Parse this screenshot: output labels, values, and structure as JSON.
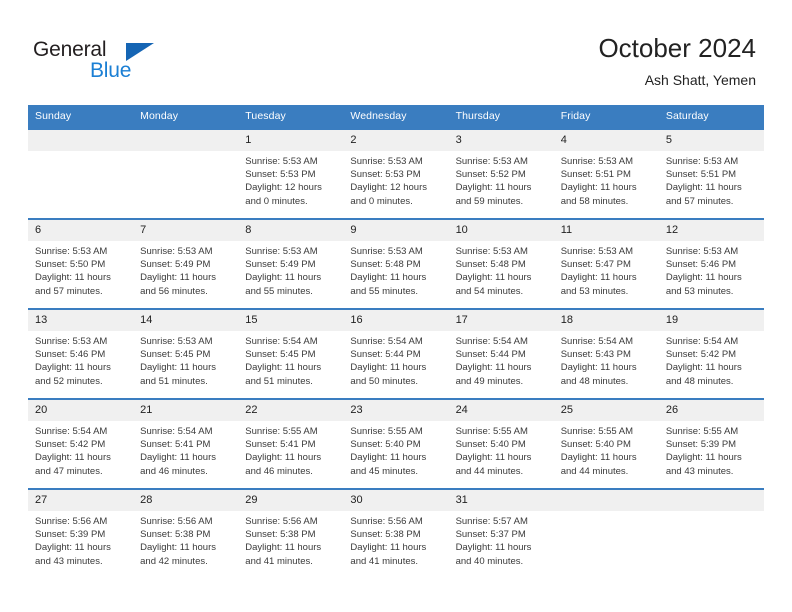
{
  "logo": {
    "word_top": "General",
    "word_bottom": "Blue",
    "triangle_color": "#1565b4",
    "blue_color": "#1b7fd4"
  },
  "header": {
    "title": "October 2024",
    "subtitle": "Ash Shatt, Yemen"
  },
  "theme": {
    "header_row_bg": "#3a7dc0",
    "daynum_bg": "#f0f0f0",
    "row_border": "#3a7dc0"
  },
  "weekdays": [
    "Sunday",
    "Monday",
    "Tuesday",
    "Wednesday",
    "Thursday",
    "Friday",
    "Saturday"
  ],
  "weeks": [
    [
      {
        "day": "",
        "sunrise": "",
        "sunset": "",
        "daylight1": "",
        "daylight2": ""
      },
      {
        "day": "",
        "sunrise": "",
        "sunset": "",
        "daylight1": "",
        "daylight2": ""
      },
      {
        "day": "1",
        "sunrise": "Sunrise: 5:53 AM",
        "sunset": "Sunset: 5:53 PM",
        "daylight1": "Daylight: 12 hours",
        "daylight2": "and 0 minutes."
      },
      {
        "day": "2",
        "sunrise": "Sunrise: 5:53 AM",
        "sunset": "Sunset: 5:53 PM",
        "daylight1": "Daylight: 12 hours",
        "daylight2": "and 0 minutes."
      },
      {
        "day": "3",
        "sunrise": "Sunrise: 5:53 AM",
        "sunset": "Sunset: 5:52 PM",
        "daylight1": "Daylight: 11 hours",
        "daylight2": "and 59 minutes."
      },
      {
        "day": "4",
        "sunrise": "Sunrise: 5:53 AM",
        "sunset": "Sunset: 5:51 PM",
        "daylight1": "Daylight: 11 hours",
        "daylight2": "and 58 minutes."
      },
      {
        "day": "5",
        "sunrise": "Sunrise: 5:53 AM",
        "sunset": "Sunset: 5:51 PM",
        "daylight1": "Daylight: 11 hours",
        "daylight2": "and 57 minutes."
      }
    ],
    [
      {
        "day": "6",
        "sunrise": "Sunrise: 5:53 AM",
        "sunset": "Sunset: 5:50 PM",
        "daylight1": "Daylight: 11 hours",
        "daylight2": "and 57 minutes."
      },
      {
        "day": "7",
        "sunrise": "Sunrise: 5:53 AM",
        "sunset": "Sunset: 5:49 PM",
        "daylight1": "Daylight: 11 hours",
        "daylight2": "and 56 minutes."
      },
      {
        "day": "8",
        "sunrise": "Sunrise: 5:53 AM",
        "sunset": "Sunset: 5:49 PM",
        "daylight1": "Daylight: 11 hours",
        "daylight2": "and 55 minutes."
      },
      {
        "day": "9",
        "sunrise": "Sunrise: 5:53 AM",
        "sunset": "Sunset: 5:48 PM",
        "daylight1": "Daylight: 11 hours",
        "daylight2": "and 55 minutes."
      },
      {
        "day": "10",
        "sunrise": "Sunrise: 5:53 AM",
        "sunset": "Sunset: 5:48 PM",
        "daylight1": "Daylight: 11 hours",
        "daylight2": "and 54 minutes."
      },
      {
        "day": "11",
        "sunrise": "Sunrise: 5:53 AM",
        "sunset": "Sunset: 5:47 PM",
        "daylight1": "Daylight: 11 hours",
        "daylight2": "and 53 minutes."
      },
      {
        "day": "12",
        "sunrise": "Sunrise: 5:53 AM",
        "sunset": "Sunset: 5:46 PM",
        "daylight1": "Daylight: 11 hours",
        "daylight2": "and 53 minutes."
      }
    ],
    [
      {
        "day": "13",
        "sunrise": "Sunrise: 5:53 AM",
        "sunset": "Sunset: 5:46 PM",
        "daylight1": "Daylight: 11 hours",
        "daylight2": "and 52 minutes."
      },
      {
        "day": "14",
        "sunrise": "Sunrise: 5:53 AM",
        "sunset": "Sunset: 5:45 PM",
        "daylight1": "Daylight: 11 hours",
        "daylight2": "and 51 minutes."
      },
      {
        "day": "15",
        "sunrise": "Sunrise: 5:54 AM",
        "sunset": "Sunset: 5:45 PM",
        "daylight1": "Daylight: 11 hours",
        "daylight2": "and 51 minutes."
      },
      {
        "day": "16",
        "sunrise": "Sunrise: 5:54 AM",
        "sunset": "Sunset: 5:44 PM",
        "daylight1": "Daylight: 11 hours",
        "daylight2": "and 50 minutes."
      },
      {
        "day": "17",
        "sunrise": "Sunrise: 5:54 AM",
        "sunset": "Sunset: 5:44 PM",
        "daylight1": "Daylight: 11 hours",
        "daylight2": "and 49 minutes."
      },
      {
        "day": "18",
        "sunrise": "Sunrise: 5:54 AM",
        "sunset": "Sunset: 5:43 PM",
        "daylight1": "Daylight: 11 hours",
        "daylight2": "and 48 minutes."
      },
      {
        "day": "19",
        "sunrise": "Sunrise: 5:54 AM",
        "sunset": "Sunset: 5:42 PM",
        "daylight1": "Daylight: 11 hours",
        "daylight2": "and 48 minutes."
      }
    ],
    [
      {
        "day": "20",
        "sunrise": "Sunrise: 5:54 AM",
        "sunset": "Sunset: 5:42 PM",
        "daylight1": "Daylight: 11 hours",
        "daylight2": "and 47 minutes."
      },
      {
        "day": "21",
        "sunrise": "Sunrise: 5:54 AM",
        "sunset": "Sunset: 5:41 PM",
        "daylight1": "Daylight: 11 hours",
        "daylight2": "and 46 minutes."
      },
      {
        "day": "22",
        "sunrise": "Sunrise: 5:55 AM",
        "sunset": "Sunset: 5:41 PM",
        "daylight1": "Daylight: 11 hours",
        "daylight2": "and 46 minutes."
      },
      {
        "day": "23",
        "sunrise": "Sunrise: 5:55 AM",
        "sunset": "Sunset: 5:40 PM",
        "daylight1": "Daylight: 11 hours",
        "daylight2": "and 45 minutes."
      },
      {
        "day": "24",
        "sunrise": "Sunrise: 5:55 AM",
        "sunset": "Sunset: 5:40 PM",
        "daylight1": "Daylight: 11 hours",
        "daylight2": "and 44 minutes."
      },
      {
        "day": "25",
        "sunrise": "Sunrise: 5:55 AM",
        "sunset": "Sunset: 5:40 PM",
        "daylight1": "Daylight: 11 hours",
        "daylight2": "and 44 minutes."
      },
      {
        "day": "26",
        "sunrise": "Sunrise: 5:55 AM",
        "sunset": "Sunset: 5:39 PM",
        "daylight1": "Daylight: 11 hours",
        "daylight2": "and 43 minutes."
      }
    ],
    [
      {
        "day": "27",
        "sunrise": "Sunrise: 5:56 AM",
        "sunset": "Sunset: 5:39 PM",
        "daylight1": "Daylight: 11 hours",
        "daylight2": "and 43 minutes."
      },
      {
        "day": "28",
        "sunrise": "Sunrise: 5:56 AM",
        "sunset": "Sunset: 5:38 PM",
        "daylight1": "Daylight: 11 hours",
        "daylight2": "and 42 minutes."
      },
      {
        "day": "29",
        "sunrise": "Sunrise: 5:56 AM",
        "sunset": "Sunset: 5:38 PM",
        "daylight1": "Daylight: 11 hours",
        "daylight2": "and 41 minutes."
      },
      {
        "day": "30",
        "sunrise": "Sunrise: 5:56 AM",
        "sunset": "Sunset: 5:38 PM",
        "daylight1": "Daylight: 11 hours",
        "daylight2": "and 41 minutes."
      },
      {
        "day": "31",
        "sunrise": "Sunrise: 5:57 AM",
        "sunset": "Sunset: 5:37 PM",
        "daylight1": "Daylight: 11 hours",
        "daylight2": "and 40 minutes."
      },
      {
        "day": "",
        "sunrise": "",
        "sunset": "",
        "daylight1": "",
        "daylight2": ""
      },
      {
        "day": "",
        "sunrise": "",
        "sunset": "",
        "daylight1": "",
        "daylight2": ""
      }
    ]
  ]
}
